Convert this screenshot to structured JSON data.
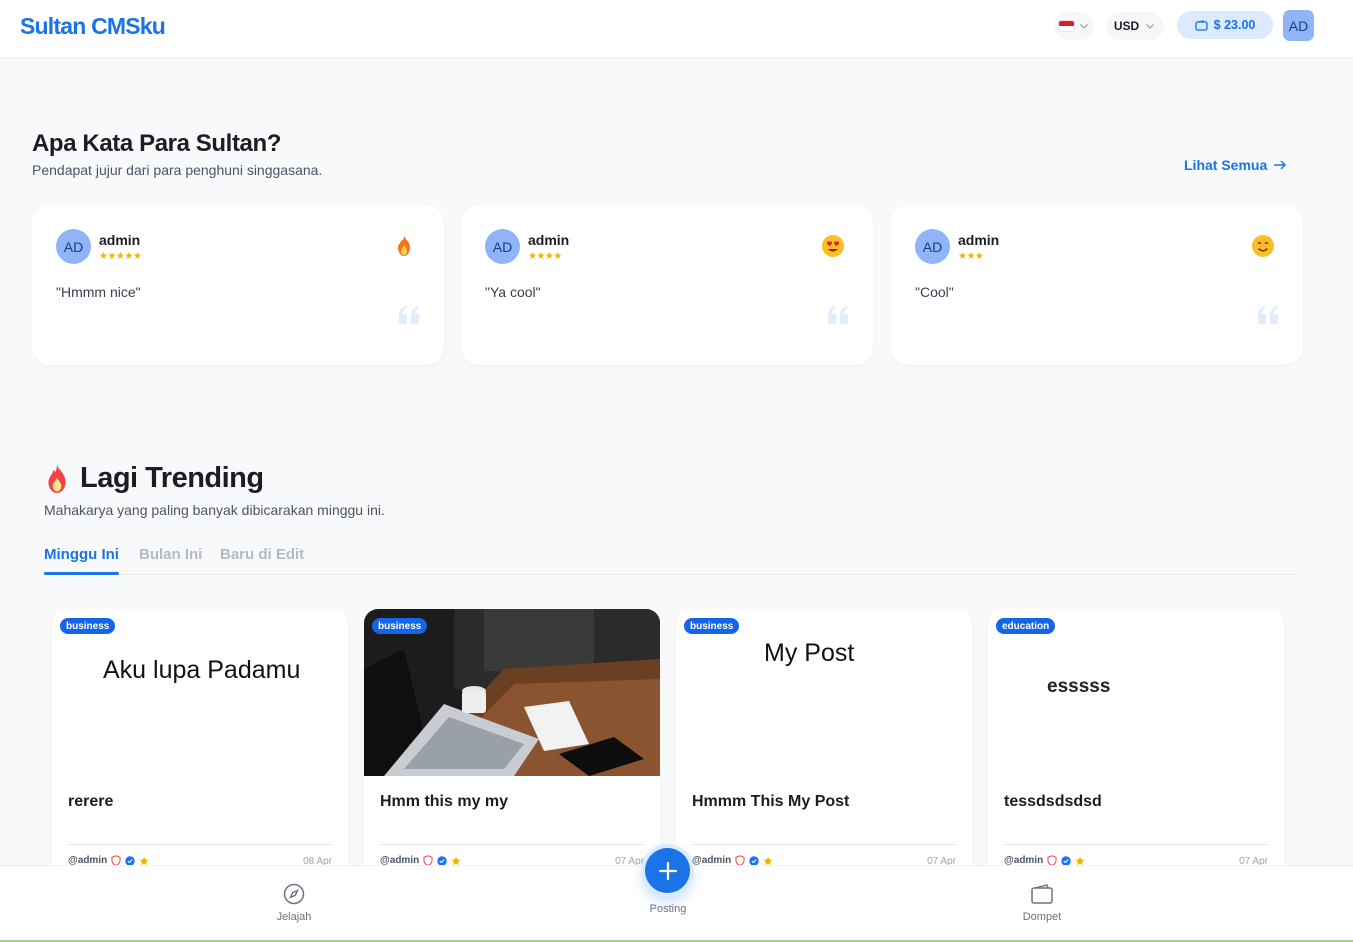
{
  "header": {
    "logo": "Sultan CMSku",
    "currency": "USD",
    "balance": "$ 23.00",
    "avatar_initials": "AD"
  },
  "testimonials": {
    "title": "Apa Kata Para Sultan?",
    "subtitle": "Pendapat jujur dari para penghuni singgasana.",
    "see_all": "Lihat Semua",
    "items": [
      {
        "initials": "AD",
        "name": "admin",
        "rating": 5,
        "stars": "★★★★★",
        "emoji": "fire-emoji",
        "quote": "\"Hmmm nice\""
      },
      {
        "initials": "AD",
        "name": "admin",
        "rating": 4,
        "stars": "★★★★",
        "emoji": "heart-eyes-emoji",
        "quote": "\"Ya cool\""
      },
      {
        "initials": "AD",
        "name": "admin",
        "rating": 3,
        "stars": "★★★",
        "emoji": "smile-emoji",
        "quote": "\"Cool\""
      }
    ]
  },
  "trending": {
    "title": "Lagi Trending",
    "subtitle": "Mahakarya yang paling banyak dibicarakan minggu ini.",
    "tabs": [
      {
        "label": "Minggu Ini",
        "active": true
      },
      {
        "label": "Bulan Ini",
        "active": false
      },
      {
        "label": "Baru di Edit",
        "active": false
      }
    ],
    "posts": [
      {
        "category": "business",
        "thumb_text": "Aku lupa Padamu",
        "title": "rerere",
        "author": "@admin",
        "date": "08 Apr"
      },
      {
        "category": "business",
        "thumb_image": "laptop-desk-photo",
        "title": "Hmm this my my",
        "author": "@admin",
        "date": "07 Apr"
      },
      {
        "category": "business",
        "thumb_text": "My Post",
        "title": "Hmmm This My Post",
        "author": "@admin",
        "date": "07 Apr"
      },
      {
        "category": "education",
        "thumb_text": "esssss",
        "title": "tessdsdsdsd",
        "author": "@admin",
        "date": "07 Apr"
      }
    ]
  },
  "nav": {
    "explore": "Jelajah",
    "post": "Posting",
    "wallet": "Dompet"
  },
  "colors": {
    "accent": "#1a73e8",
    "badge": "#1565e8",
    "star": "#f5b301",
    "avatar": "#8fb4f7"
  }
}
